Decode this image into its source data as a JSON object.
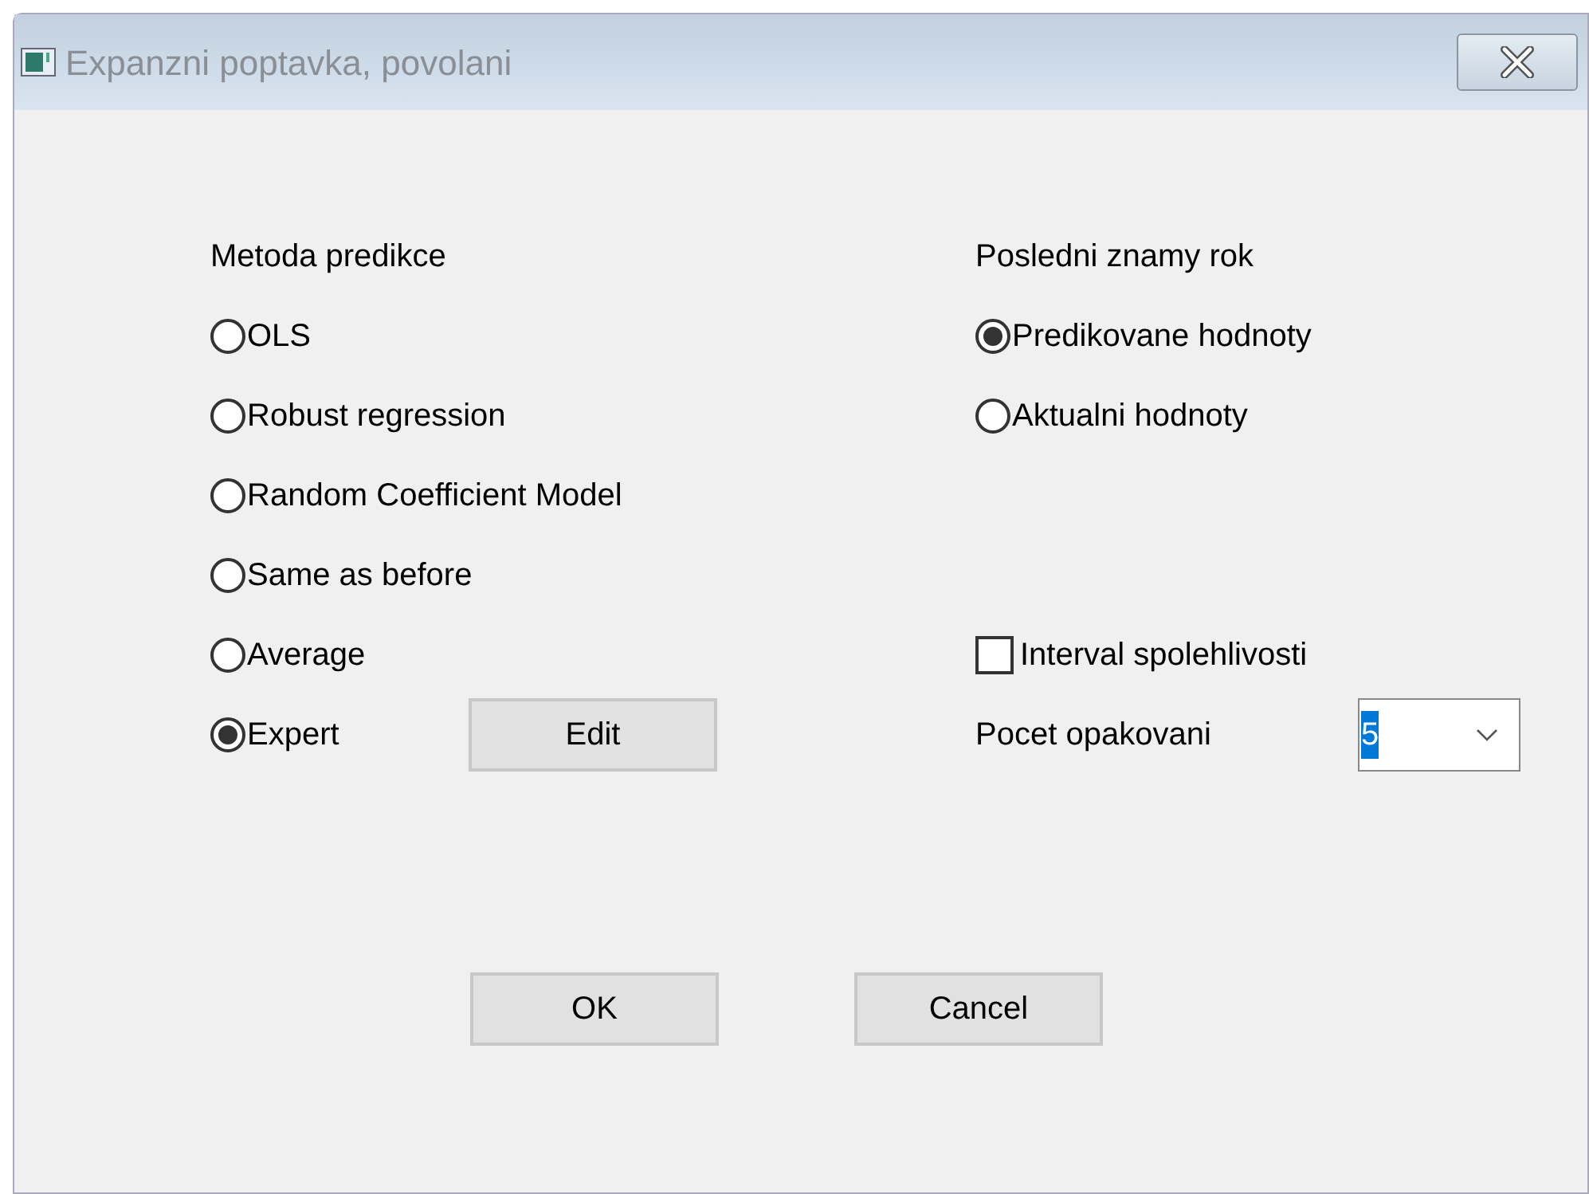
{
  "window": {
    "title": "Expanzni poptavka, povolani"
  },
  "method": {
    "heading": "Metoda predikce",
    "options": [
      {
        "label": "OLS",
        "selected": false
      },
      {
        "label": "Robust regression",
        "selected": false
      },
      {
        "label": "Random Coefficient Model",
        "selected": false
      },
      {
        "label": "Same as before",
        "selected": false
      },
      {
        "label": "Average",
        "selected": false
      },
      {
        "label": "Expert",
        "selected": true
      }
    ],
    "edit_button": "Edit"
  },
  "last_year": {
    "heading": "Posledni znamy rok",
    "options": [
      {
        "label": "Predikovane hodnoty",
        "selected": true
      },
      {
        "label": "Aktualni hodnoty",
        "selected": false
      }
    ]
  },
  "confidence_interval": {
    "label": "Interval spolehlivosti",
    "checked": false
  },
  "repetitions": {
    "label": "Pocet opakovani",
    "value": "5"
  },
  "buttons": [
    "OK",
    "Cancel"
  ]
}
